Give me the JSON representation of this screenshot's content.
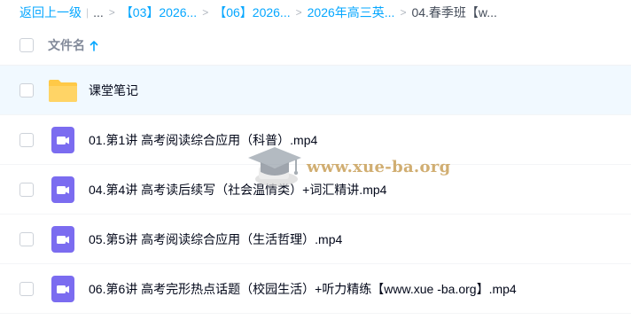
{
  "breadcrumb": {
    "back_label": "返回上一级",
    "ellipsis": "...",
    "items": [
      "【03】2026...",
      "【06】2026...",
      "2026年高三英..."
    ],
    "current": "04.春季班【w..."
  },
  "header": {
    "name_column": "文件名"
  },
  "files": [
    {
      "name": "课堂笔记",
      "type": "folder-icon"
    },
    {
      "name": "01.第1讲 高考阅读综合应用（科普）.mp4",
      "type": "video-file-icon"
    },
    {
      "name": "04.第4讲 高考读后续写（社会温情类）+词汇精讲.mp4",
      "type": "video-file-icon"
    },
    {
      "name": "05.第5讲 高考阅读综合应用（生活哲理）.mp4",
      "type": "video-file-icon"
    },
    {
      "name": "06.第6讲 高考完形热点话题（校园生活）+听力精练【www.xue -ba.org】.mp4",
      "type": "video-file-icon"
    }
  ],
  "watermark": {
    "text": "www.xue-ba.org"
  },
  "colors": {
    "accent": "#06a7ff",
    "folder": "#ffc947",
    "video": "#7b6cf0",
    "selected_row": "#f1f9ff"
  }
}
